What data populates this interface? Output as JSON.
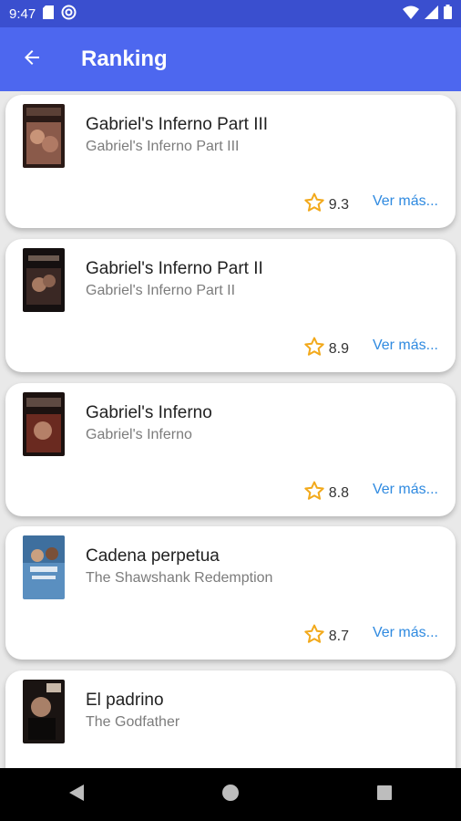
{
  "status_bar": {
    "time": "9:47",
    "icons_left": [
      "sd-card-icon",
      "at-sign-icon"
    ],
    "icons_right": [
      "wifi-icon",
      "signal-icon",
      "battery-icon"
    ]
  },
  "app_bar": {
    "title": "Ranking",
    "back_icon": "arrow-left-icon",
    "color": "#4d67ef"
  },
  "items": [
    {
      "title": "Gabriel's Inferno Part III",
      "subtitle": "Gabriel's Inferno Part III",
      "rating": "9.3",
      "more": "Ver más..."
    },
    {
      "title": "Gabriel's Inferno Part II",
      "subtitle": "Gabriel's Inferno Part II",
      "rating": "8.9",
      "more": "Ver más..."
    },
    {
      "title": "Gabriel's Inferno",
      "subtitle": "Gabriel's Inferno",
      "rating": "8.8",
      "more": "Ver más..."
    },
    {
      "title": "Cadena perpetua",
      "subtitle": "The Shawshank Redemption",
      "rating": "8.7",
      "more": "Ver más..."
    },
    {
      "title": "El padrino",
      "subtitle": "The Godfather",
      "rating": "",
      "more": ""
    }
  ],
  "colors": {
    "star": "#f2a91b",
    "link": "#2f8ae0"
  },
  "nav_bar": {
    "icons": [
      "back-triangle-icon",
      "home-circle-icon",
      "recents-square-icon"
    ]
  }
}
